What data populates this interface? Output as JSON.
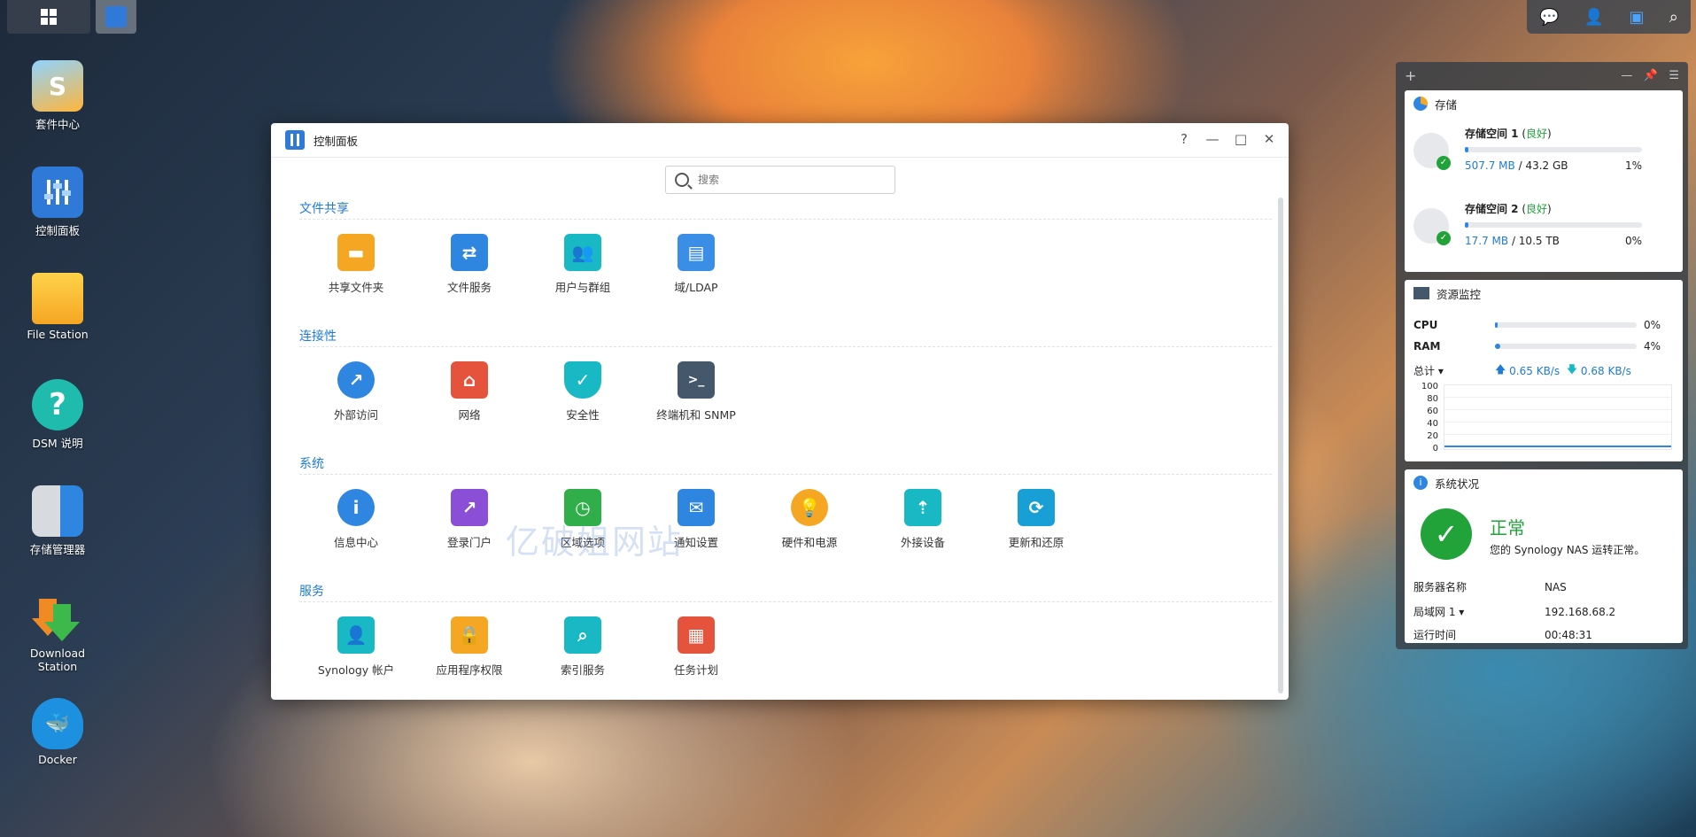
{
  "desktop": {
    "icons": [
      {
        "label": "套件中心",
        "icon": "package-center-icon"
      },
      {
        "label": "控制面板",
        "icon": "control-panel-icon"
      },
      {
        "label": "File Station",
        "icon": "folder-icon"
      },
      {
        "label": "DSM 说明",
        "icon": "help-icon"
      },
      {
        "label": "存储管理器",
        "icon": "storage-manager-icon"
      },
      {
        "label": "Download Station",
        "icon": "download-icon"
      },
      {
        "label": "Docker",
        "icon": "docker-icon"
      }
    ]
  },
  "tray": {
    "icons": [
      "chat-icon",
      "user-icon",
      "widgets-icon",
      "search-icon"
    ]
  },
  "window": {
    "title": "控制面板",
    "controls": {
      "help": "?",
      "minimize": "—",
      "maximize": "□",
      "close": "✕"
    },
    "search": {
      "placeholder": "搜索"
    },
    "sections": [
      {
        "title": "文件共享",
        "items": [
          {
            "label": "共享文件夹",
            "icon": "shared-folder-icon",
            "color": "#f5a623"
          },
          {
            "label": "文件服务",
            "icon": "file-services-icon",
            "color": "#2f86e0"
          },
          {
            "label": "用户与群组",
            "icon": "user-group-icon",
            "color": "#18b9c4"
          },
          {
            "label": "域/LDAP",
            "icon": "ldap-icon",
            "color": "#3a8ee6"
          }
        ]
      },
      {
        "title": "连接性",
        "items": [
          {
            "label": "外部访问",
            "icon": "external-access-icon",
            "color": "#2f86e0"
          },
          {
            "label": "网络",
            "icon": "network-icon",
            "color": "#e5533d"
          },
          {
            "label": "安全性",
            "icon": "security-icon",
            "color": "#18b9c4"
          },
          {
            "label": "终端机和 SNMP",
            "icon": "terminal-icon",
            "color": "#45576b"
          }
        ]
      },
      {
        "title": "系统",
        "items": [
          {
            "label": "信息中心",
            "icon": "info-center-icon",
            "color": "#2f86e0"
          },
          {
            "label": "登录门户",
            "icon": "login-portal-icon",
            "color": "#8a4fd6"
          },
          {
            "label": "区域选项",
            "icon": "regional-options-icon",
            "color": "#2fae4a"
          },
          {
            "label": "通知设置",
            "icon": "notification-icon",
            "color": "#2f86e0"
          },
          {
            "label": "硬件和电源",
            "icon": "hardware-power-icon",
            "color": "#f5a623"
          },
          {
            "label": "外接设备",
            "icon": "external-devices-icon",
            "color": "#18b9c4"
          },
          {
            "label": "更新和还原",
            "icon": "update-restore-icon",
            "color": "#18a0d6"
          }
        ]
      },
      {
        "title": "服务",
        "items": [
          {
            "label": "Synology 帐户",
            "icon": "synology-account-icon",
            "color": "#18b9c4"
          },
          {
            "label": "应用程序权限",
            "icon": "app-privileges-icon",
            "color": "#f5a623"
          },
          {
            "label": "索引服务",
            "icon": "indexing-service-icon",
            "color": "#18b9c4"
          },
          {
            "label": "任务计划",
            "icon": "task-scheduler-icon",
            "color": "#e5533d"
          }
        ]
      }
    ],
    "watermark": "亿破姐网站"
  },
  "widgets": {
    "storage": {
      "title": "存储",
      "volumes": [
        {
          "name": "存储空间 1",
          "status": "良好",
          "used": "507.7 MB",
          "sep": " / ",
          "total": "43.2 GB",
          "percent": "1%",
          "fill": 0.01
        },
        {
          "name": "存储空间 2",
          "status": "良好",
          "used": "17.7 MB",
          "sep": " / ",
          "total": "10.5 TB",
          "percent": "0%",
          "fill": 0.0
        }
      ]
    },
    "resource": {
      "title": "资源监控",
      "cpu_label": "CPU",
      "cpu_value": "0%",
      "cpu_fill": 0.0,
      "ram_label": "RAM",
      "ram_value": "4%",
      "ram_fill": 0.04,
      "total_label": "总计 ▾",
      "upload": "0.65 KB/s",
      "download": "0.68 KB/s",
      "chart_ticks": [
        "100",
        "80",
        "60",
        "40",
        "20",
        "0"
      ]
    },
    "system": {
      "title": "系统状况",
      "status": "正常",
      "status_desc": "您的 Synology NAS 运转正常。",
      "rows": [
        {
          "label": "服务器名称",
          "value": "NAS"
        },
        {
          "label": "局域网 1 ▾",
          "value": "192.168.68.2"
        },
        {
          "label": "运行时间",
          "value": "00:48:31"
        }
      ]
    }
  }
}
